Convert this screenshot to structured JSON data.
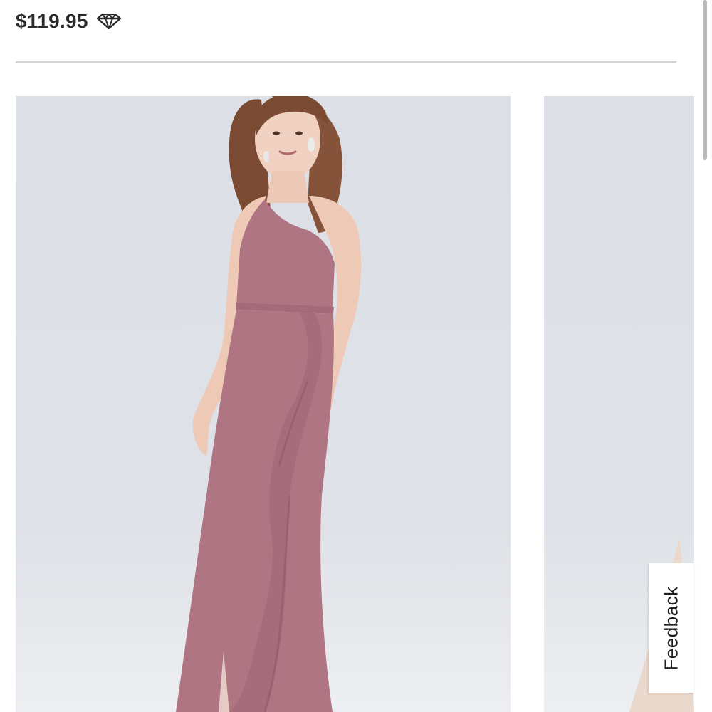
{
  "product": {
    "price": "$119.95",
    "diamond_icon": "diamond-icon"
  },
  "gallery": {
    "main_image_alt": "Model wearing a mauve one-shoulder chiffon bridesmaid gown with cascading ruffle skirt",
    "next_image_alt": "Next product image"
  },
  "feedback": {
    "label": "Feedback"
  },
  "colors": {
    "text": "#2b2b2b",
    "dress": "#b07583",
    "backdrop": "#dfe2e8"
  }
}
